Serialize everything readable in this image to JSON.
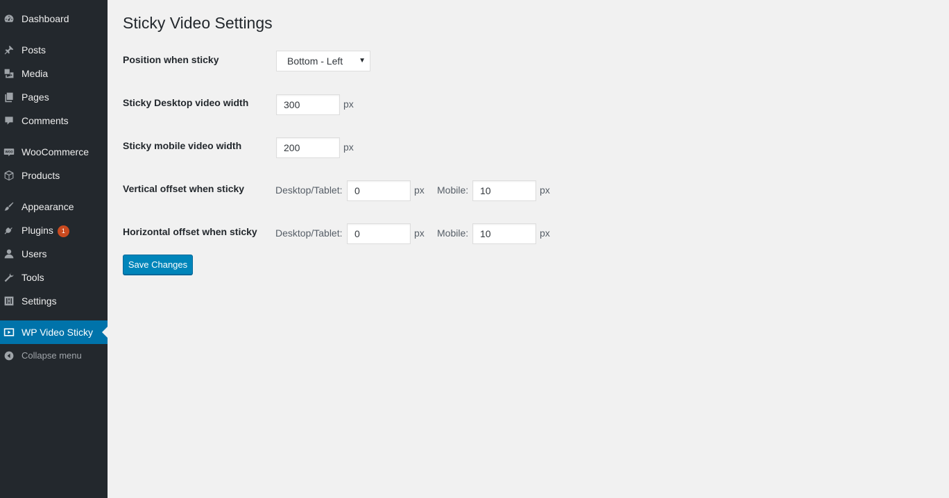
{
  "sidebar": {
    "items": [
      {
        "label": "Dashboard",
        "icon": "dashboard-icon"
      },
      {
        "label": "Posts",
        "icon": "pin-icon"
      },
      {
        "label": "Media",
        "icon": "media-icon"
      },
      {
        "label": "Pages",
        "icon": "pages-icon"
      },
      {
        "label": "Comments",
        "icon": "comment-icon"
      },
      {
        "label": "WooCommerce",
        "icon": "woocommerce-icon"
      },
      {
        "label": "Products",
        "icon": "box-icon"
      },
      {
        "label": "Appearance",
        "icon": "brush-icon"
      },
      {
        "label": "Plugins",
        "icon": "plug-icon",
        "badge": "1"
      },
      {
        "label": "Users",
        "icon": "user-icon"
      },
      {
        "label": "Tools",
        "icon": "wrench-icon"
      },
      {
        "label": "Settings",
        "icon": "settings-icon"
      },
      {
        "label": "WP Video Sticky",
        "icon": "video-icon"
      },
      {
        "label": "Collapse menu",
        "icon": "collapse-icon"
      }
    ],
    "active_item": "WP Video Sticky"
  },
  "main": {
    "title": "Sticky Video Settings",
    "position": {
      "label": "Position when sticky",
      "selected": "Bottom - Left"
    },
    "desktop_width": {
      "label": "Sticky Desktop video width",
      "value": "300",
      "unit": "px"
    },
    "mobile_width": {
      "label": "Sticky mobile video width",
      "value": "200",
      "unit": "px"
    },
    "vertical_offset": {
      "label": "Vertical offset when sticky",
      "desktop_label": "Desktop/Tablet:",
      "desktop_value": "0",
      "desktop_unit": "px",
      "mobile_label": "Mobile:",
      "mobile_value": "10",
      "mobile_unit": "px"
    },
    "horizontal_offset": {
      "label": "Horizontal offset when sticky",
      "desktop_label": "Desktop/Tablet:",
      "desktop_value": "0",
      "desktop_unit": "px",
      "mobile_label": "Mobile:",
      "mobile_value": "10",
      "mobile_unit": "px"
    },
    "save_label": "Save Changes"
  },
  "colors": {
    "sidebar_bg": "#23282d",
    "active_bg": "#0073aa",
    "button_bg": "#0085ba",
    "badge_bg": "#ca4a1f",
    "page_bg": "#f1f1f1"
  }
}
